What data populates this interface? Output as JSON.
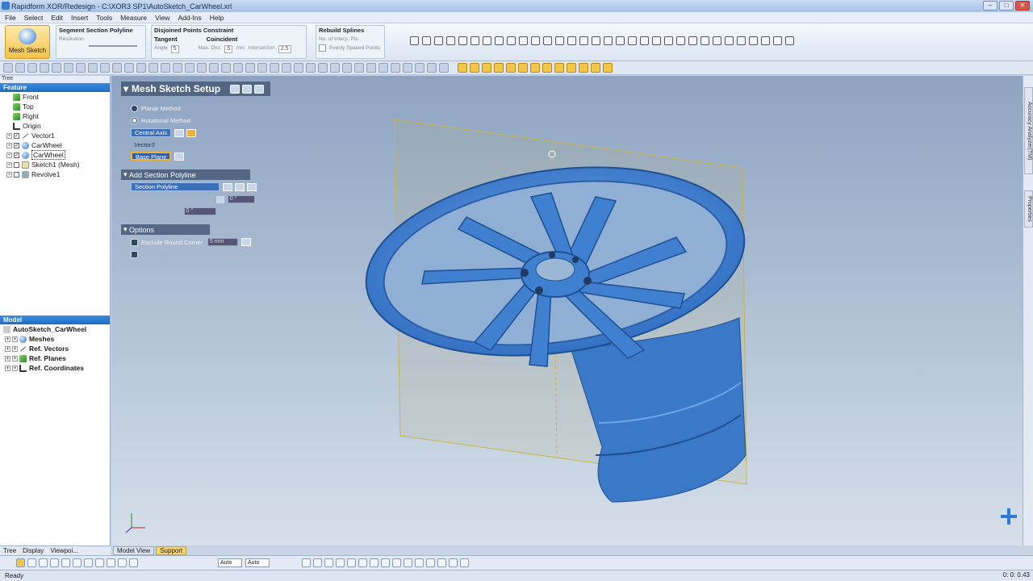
{
  "window": {
    "title": "Rapidform XOR/Redesign - C:\\XOR3 SP1\\AutoSketch_CarWheel.xrl"
  },
  "menu": [
    "File",
    "Select",
    "Edit",
    "Insert",
    "Tools",
    "Measure",
    "View",
    "Add-Ins",
    "Help"
  ],
  "ribbon": {
    "mesh_sketch": "Mesh Sketch",
    "segment_title": "Segment Section Polyline",
    "segment_sub": "Resolution",
    "disjoined_title": "Disjoined Points Constraint",
    "tangent": "Tangent",
    "coincident": "Coincident",
    "angle_label": "Angle",
    "angle_val": "5",
    "maxdist_label": "Max. Dist.",
    "maxdist_val": "5",
    "mm": "mm",
    "intersection_label": "Intersection",
    "intersection_val": "2.5",
    "rebuild_title": "Rebuild Splines",
    "rebuild_sub": "No. of Interp. Pts",
    "rebuild_val": "0",
    "evenly": "Evenly Spaced Points"
  },
  "tree": {
    "caption": "Tree",
    "feature_header": "Feature",
    "items": [
      {
        "label": "Front",
        "icon": "plane-icon"
      },
      {
        "label": "Top",
        "icon": "plane-icon"
      },
      {
        "label": "Right",
        "icon": "plane-icon"
      },
      {
        "label": "Origin",
        "icon": "origin-icon"
      },
      {
        "label": "Vector1",
        "icon": "vector-icon"
      },
      {
        "label": "CarWheel",
        "icon": "mesh-icon"
      },
      {
        "label": "CarWheel",
        "icon": "mesh-icon"
      },
      {
        "label": "Sketch1 (Mesh)",
        "icon": "sketch-icon"
      },
      {
        "label": "Revolve1",
        "icon": "revolve-icon"
      }
    ],
    "model_header": "Model",
    "model_root": "AutoSketch_CarWheel",
    "model_items": [
      "Meshes",
      "Ref. Vectors",
      "Ref. Planes",
      "Ref. Coordinates"
    ]
  },
  "left_tabs": [
    "Tree",
    "Display",
    "Viewpoi..."
  ],
  "setup": {
    "title": "Mesh Sketch Setup",
    "planar": "Planar Method",
    "rotational": "Rotational Method",
    "central_axis": "Central Axis",
    "vector_name": "Vector3",
    "base_plane": "Base Plane",
    "add_section": "Add Section Polyline",
    "section_polyline": "Section Polyline",
    "offset_angle": "Offset Angle From Base Plane",
    "offset_val": "0 °",
    "silhouette": "Silhouette Range",
    "silhouette_val": "0 °",
    "options": "Options",
    "exclude": "Exclude Round Corner",
    "exclude_val": "5 mm",
    "avg": "Avg. Section"
  },
  "right_tabs": [
    "Accuracy Analyzer(TM)",
    "Properties"
  ],
  "view_tabs": [
    "Model View",
    "Support"
  ],
  "bottom": {
    "combo1": "Auto",
    "combo2": "Auto"
  },
  "status": {
    "left": "Ready",
    "right": "0: 0: 0.43"
  }
}
